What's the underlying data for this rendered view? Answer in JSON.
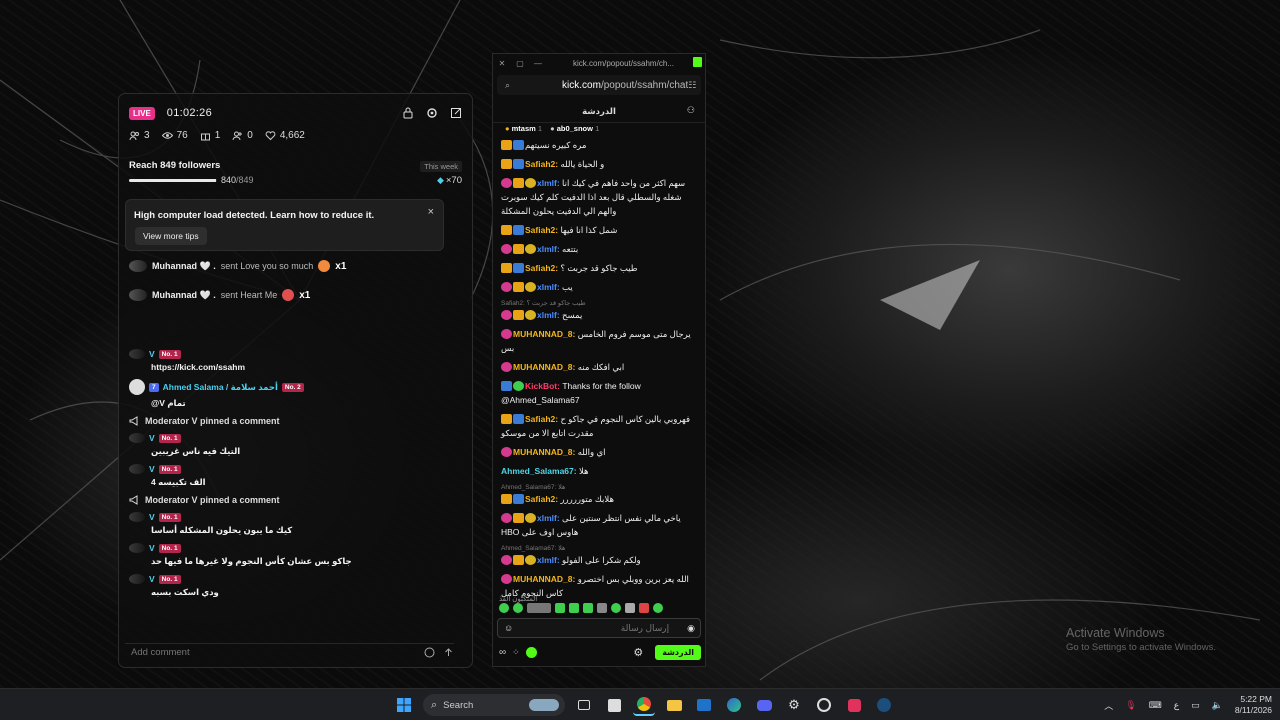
{
  "dashboard": {
    "live_label": "LIVE",
    "timer": "01:02:26",
    "stats": {
      "hosts": "3",
      "viewers": "76",
      "subs": "1",
      "followers_gained": "0",
      "likes": "4,662"
    },
    "goal": {
      "title": "Reach 849 followers",
      "current": "840",
      "target": "849",
      "progress": 0.99,
      "week_label": "This week",
      "multiplier": "×70"
    },
    "alert": {
      "text": "High computer load detected. Learn how to reduce it.",
      "button": "View more tips",
      "close": "×"
    },
    "gifts": [
      {
        "user": "Muhannad 🤍 .",
        "message": "sent Love you so much",
        "qty": "x1"
      },
      {
        "user": "Muhannad 🤍 .",
        "message": "sent Heart Me",
        "qty": "x1"
      }
    ],
    "feed": [
      {
        "user": "V",
        "badge": "No. 1",
        "text": "https://kick.com/ssahm"
      },
      {
        "user": "Ahmed Salama / أحمد سلامة",
        "badge": "No. 2",
        "level": "7",
        "text": "@V تمام"
      },
      {
        "pin": "Moderator V pinned a comment"
      },
      {
        "user": "V",
        "badge": "No. 1",
        "text": "التيك فيه ناس غريبين"
      },
      {
        "user": "V",
        "badge": "No. 1",
        "text": "الف تكبيسه 4"
      },
      {
        "pin": "Moderator V pinned a comment"
      },
      {
        "user": "V",
        "badge": "No. 1",
        "text": "كيك ما يبون يحلون المشكله أساسا"
      },
      {
        "user": "V",
        "badge": "No. 1",
        "text": "جاكو بس عشان كأس النجوم ولا غيرها ما فيها حد"
      },
      {
        "user": "V",
        "badge": "No. 1",
        "text": "ودي اسكت بسبه"
      }
    ],
    "pin_moderator": "Moderator",
    "pin_user": "V",
    "pin_suffix": "pinned a comment",
    "comment_placeholder": "Add comment"
  },
  "popout": {
    "title_url": "kick.com/popout/ssahm/ch...",
    "address_host": "kick.com",
    "address_path": "/popout/ssahm/chat",
    "header": "الدردشة",
    "pinned_users": [
      {
        "name": "mtasm",
        "count": "1"
      },
      {
        "name": "ab0_snow",
        "count": "1"
      }
    ],
    "messages": [
      {
        "name": "",
        "text": "مره كبيره نسيتهم",
        "style": "plain"
      },
      {
        "name": "Safiah2:",
        "text": "و الحياة يالله",
        "style": "yellow"
      },
      {
        "name": "xlmlf:",
        "text": "سهم اكثر من واحد فاهم في كيك انا شغله والسطلي قال بعد اذا الدفيت كلم كيك سوبرت والهم الي الدفيت يحلون المشكلة",
        "style": "blue"
      },
      {
        "name": "Safiah2:",
        "text": "شمل كذا انا فيها",
        "style": "yellow"
      },
      {
        "name": "xlmlf:",
        "text": "بتتعه",
        "style": "blue"
      },
      {
        "name": "Safiah2:",
        "text": "طيب جاكو قد جربت ؟",
        "style": "yellow"
      },
      {
        "name": "xlmlf:",
        "text": "يب",
        "style": "blue"
      },
      {
        "name": "xlmlf:",
        "text": "يمسح",
        "style": "blue",
        "reply": "Safiah2: طيب جاكو قد جربت ؟"
      },
      {
        "name": "MUHANNAD_8:",
        "text": "يرجال متى موسم فروم الخامس بس",
        "style": "orange"
      },
      {
        "name": "MUHANNAD_8:",
        "text": "ابي افكك منه",
        "style": "orange"
      },
      {
        "name": "KickBot:",
        "text": "Thanks for the follow @Ahmed_Salama67",
        "style": "red"
      },
      {
        "name": "Safiah2:",
        "text": "فهروبي بالين كاس النجوم في جاكو ح مقدرت اتابع الا من موسكو",
        "style": "yellow"
      },
      {
        "name": "MUHANNAD_8:",
        "text": "اي والله",
        "style": "orange"
      },
      {
        "name": "Ahmed_Salama67:",
        "text": "هلا",
        "style": "cyan"
      },
      {
        "name": "Safiah2:",
        "text": "هلابك متوررررر",
        "style": "yellow",
        "reply": "Ahmed_Salama67: هلا"
      },
      {
        "name": "xlmlf:",
        "text": "ياخي مالي نفس انتظر سنتين على هاوس اوف على HBO",
        "style": "blue"
      },
      {
        "name": "xlmlf:",
        "text": "ولكم شكرا على الفولو",
        "style": "blue",
        "reply": "Ahmed_Salama67: هلا"
      },
      {
        "name": "MUHANNAD_8:",
        "text": "الله يعز برين ووبلي بس اختصرو كاس النجوم كامل",
        "style": "orange"
      }
    ],
    "emote_label": "المتكبون الفذ",
    "input_placeholder": "إرسال رسالة",
    "chat_button": "الدردشة"
  },
  "watermark": {
    "line1": "Activate Windows",
    "line2": "Go to Settings to activate Windows."
  },
  "taskbar": {
    "search": "Search",
    "lang": "ع",
    "time": "5:22 PM",
    "date": "8/11/2026"
  },
  "colors": {
    "kick_green": "#53fc18",
    "live_pink": "#e8308a",
    "taskbar": "#1d1f22"
  }
}
